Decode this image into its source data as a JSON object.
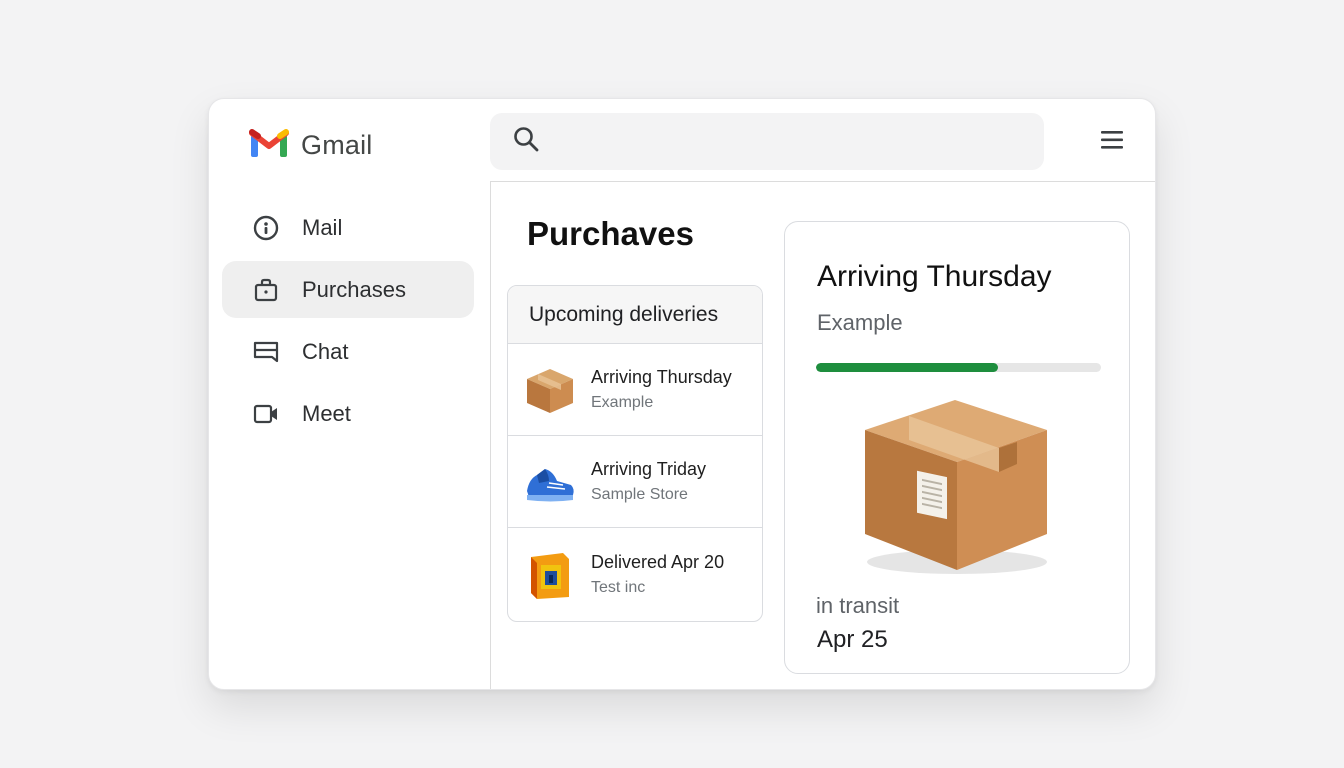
{
  "app": {
    "name": "Gmail"
  },
  "sidebar": {
    "items": [
      {
        "label": "Mail",
        "icon": "info-circle-icon",
        "active": false
      },
      {
        "label": "Purchases",
        "icon": "shopping-bag-icon",
        "active": true
      },
      {
        "label": "Chat",
        "icon": "chat-icon",
        "active": false
      },
      {
        "label": "Meet",
        "icon": "video-camera-icon",
        "active": false
      }
    ]
  },
  "search": {
    "placeholder": "",
    "icon": "search-icon"
  },
  "header": {
    "menu_icon": "hamburger-menu-icon"
  },
  "main": {
    "title": "Purchaves",
    "deliveries": {
      "heading": "Upcoming deliveries",
      "items": [
        {
          "title": "Arriving Thursday",
          "store": "Example",
          "icon": "package-box-icon"
        },
        {
          "title": "Arriving Triday",
          "store": "Sample Store",
          "icon": "blue-sneaker-icon"
        },
        {
          "title": "Delivered Apr 20",
          "store": "Test inc",
          "icon": "orange-box-icon"
        }
      ]
    },
    "detail": {
      "title": "Arriving Thursday",
      "store": "Example",
      "progress": 0.64,
      "status": "in transit",
      "date": "Apr 25",
      "image_icon": "package-box-icon"
    }
  },
  "colors": {
    "progress_fill": "#1e8e3e",
    "active_nav_bg": "#efefef",
    "search_bg": "#f3f3f4"
  }
}
